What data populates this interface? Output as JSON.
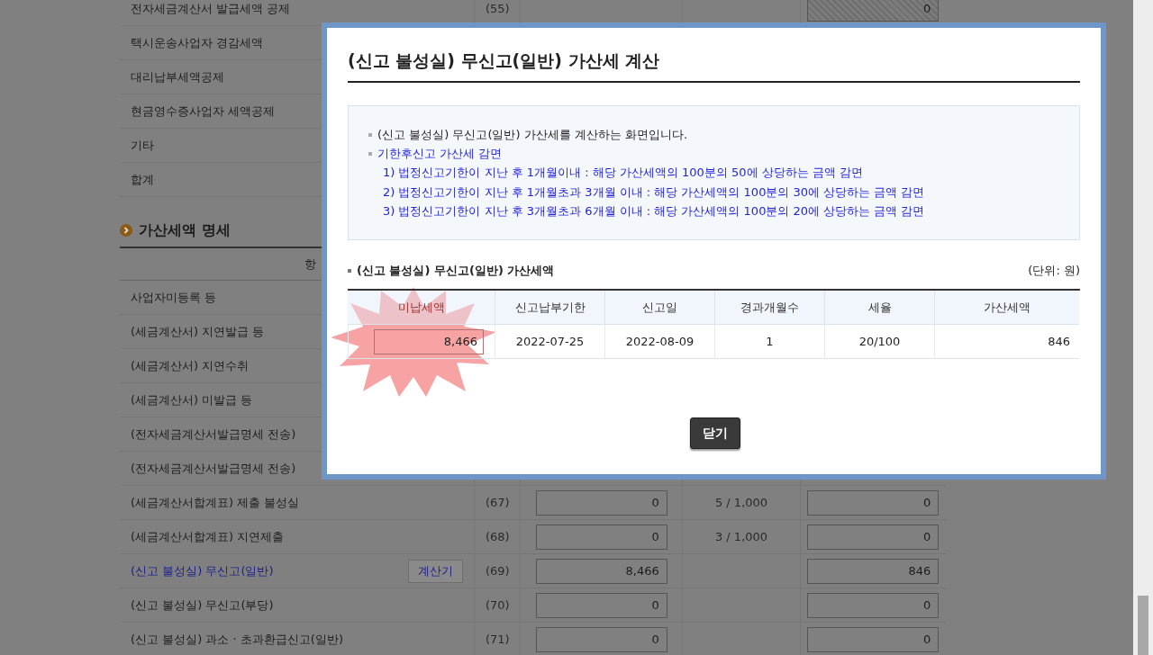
{
  "form": {
    "top_rows": [
      {
        "label": "전자세금계산서 발급세액 공제",
        "code": "(55)",
        "tax": "0",
        "disabled": true
      },
      {
        "label": "택시운송사업자 경감세액"
      },
      {
        "label": "대리납부세액공제"
      },
      {
        "label": "현금영수증사업자 세액공제"
      },
      {
        "label": "기타"
      },
      {
        "label": "합계"
      }
    ],
    "section_title": "가산세액 명세",
    "header_label": "항",
    "rows": [
      {
        "label": "사업자미등록 등",
        "kind": "plain"
      },
      {
        "label": "(세금계산서) 지연발급 등",
        "kind": "plain"
      },
      {
        "label": "(세금계산서) 지연수취",
        "kind": "plain"
      },
      {
        "label": "(세금계산서) 미발급 등",
        "kind": "plain"
      },
      {
        "label": "(전자세금계산서발급명세 전송)",
        "kind": "plain"
      },
      {
        "label": "(전자세금계산서발급명세 전송)",
        "kind": "plain"
      },
      {
        "label": "(세금계산서합계표) 제출 불성실",
        "kind": "plain",
        "code": "(67)",
        "amount": "0",
        "rate": "5 / 1,000",
        "tax": "0"
      },
      {
        "label": "(세금계산서합계표) 지연제출",
        "kind": "plain",
        "code": "(68)",
        "amount": "0",
        "rate": "3 / 1,000",
        "tax": "0"
      },
      {
        "label": "(신고 불성실) 무신고(일반)",
        "kind": "link",
        "button": "계산기",
        "code": "(69)",
        "amount": "8,466",
        "tax": "846"
      },
      {
        "label": "(신고 불성실) 무신고(부당)",
        "kind": "plain",
        "code": "(70)",
        "amount": "0",
        "tax": "0"
      },
      {
        "label": "(신고 불성실) 과소 · 초과환급신고(일반)",
        "kind": "plain",
        "code": "(71)",
        "amount": "0",
        "tax": "0"
      }
    ]
  },
  "dialog": {
    "title": "(신고 불성실) 무신고(일반) 가산세 계산",
    "notes": [
      {
        "text": "(신고 불성실) 무신고(일반) 가산세를 계산하는 화면입니다.",
        "kind": "bullet"
      },
      {
        "text": "기한후신고 가산세 감면",
        "kind": "bullet-blue"
      },
      {
        "text": "1) 법정신고기한이 지난 후 1개월이내 : 해당 가산세액의 100분의 50에 상당하는 금액 감면",
        "kind": "sub"
      },
      {
        "text": "2) 법정신고기한이 지난 후 1개월초과 3개월 이내 : 해당 가산세액의 100분의 30에 상당하는 금액 감면",
        "kind": "sub"
      },
      {
        "text": "3) 법정신고기한이 지난 후 3개월초과 6개월 이내 : 해당 가산세액의 100분의 20에 상당하는 금액 감면",
        "kind": "sub"
      }
    ],
    "section_title": "(신고 불성실) 무신고(일반) 가산세액",
    "unit": "(단위: 원)",
    "columns": [
      "미납세액",
      "신고납부기한",
      "신고일",
      "경과개월수",
      "세율",
      "가산세액"
    ],
    "row": {
      "unpaid": "8,466",
      "due_date": "2022-07-25",
      "filed_date": "2022-08-09",
      "months": "1",
      "rate": "20/100",
      "penalty": "846"
    },
    "highlight": true,
    "close_button": "닫기"
  }
}
